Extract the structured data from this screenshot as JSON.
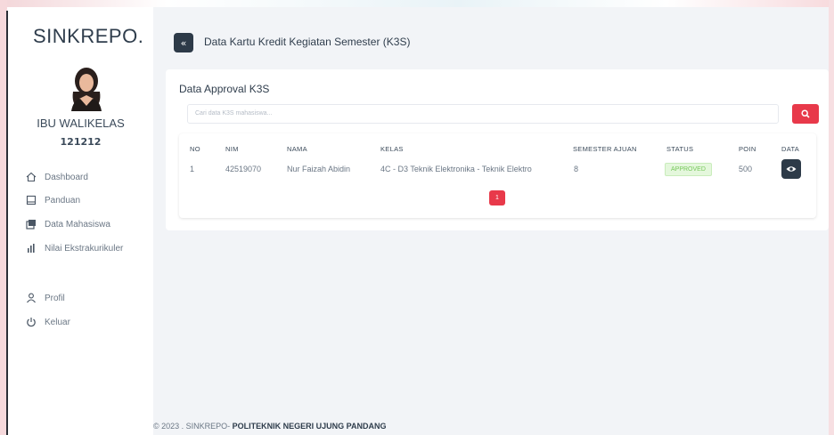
{
  "sidebar": {
    "brand": "SINKREPO.",
    "user": {
      "name": "IBU WALIKELAS",
      "id": "121212"
    },
    "menu": [
      {
        "label": "Dashboard",
        "icon": "home-icon"
      },
      {
        "label": "Panduan",
        "icon": "book-icon"
      },
      {
        "label": "Data Mahasiswa",
        "icon": "books-icon"
      },
      {
        "label": "Nilai Ekstrakurikuler",
        "icon": "bar-chart-icon"
      }
    ],
    "menu2": [
      {
        "label": "Profil",
        "icon": "user-icon"
      },
      {
        "label": "Keluar",
        "icon": "power-icon"
      }
    ]
  },
  "header": {
    "back_label": "«",
    "title": "Data Kartu Kredit Kegiatan Semester (K3S)"
  },
  "card": {
    "title": "Data Approval K3S",
    "search_placeholder": "Cari data K3S mahasiswa...",
    "columns": [
      "NO",
      "NIM",
      "NAMA",
      "KELAS",
      "SEMESTER AJUAN",
      "STATUS",
      "POIN",
      "DATA"
    ],
    "rows": [
      {
        "no": "1",
        "nim": "42519070",
        "nama": "Nur Faizah Abidin",
        "kelas": "4C - D3 Teknik Elektronika - Teknik Elektro",
        "semester": "8",
        "status": "APPROVED",
        "poin": "500"
      }
    ],
    "pagination": {
      "current": "1"
    }
  },
  "footer": {
    "prefix": "© 2023 . SINKREPO- ",
    "org": "POLITEKNIK NEGERI UJUNG PANDANG"
  },
  "colors": {
    "accent": "#e8394a",
    "dark": "#2d3a48",
    "success_bg": "#e4f7dc",
    "success_text": "#77c85c",
    "main_bg": "#f2f4f7"
  }
}
